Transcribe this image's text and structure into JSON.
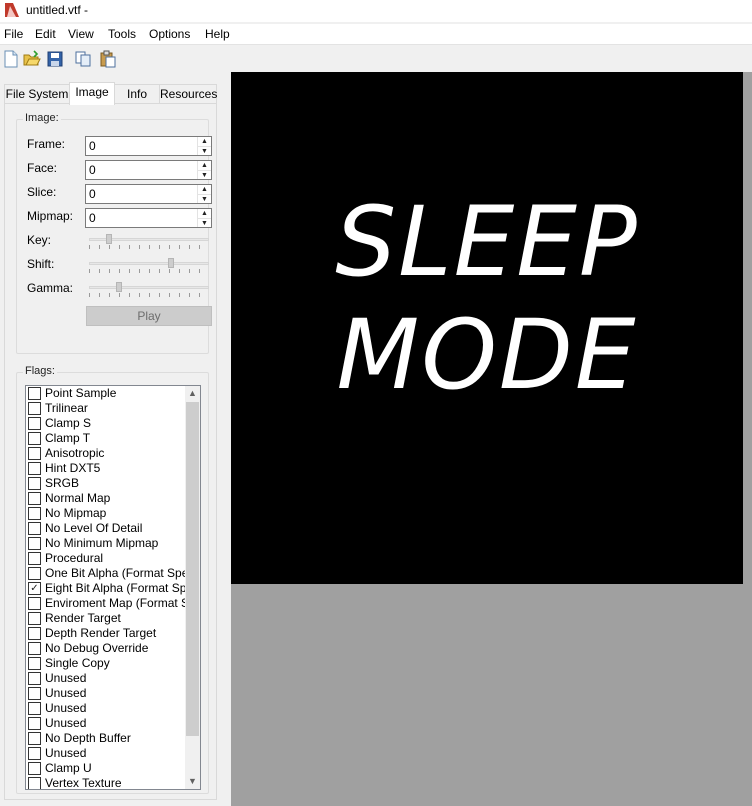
{
  "window": {
    "title": "untitled.vtf -"
  },
  "menu": [
    "File",
    "Edit",
    "View",
    "Tools",
    "Options",
    "Help"
  ],
  "toolbar": {
    "icons": [
      "new-icon",
      "open-icon",
      "save-icon",
      "copy-icon",
      "paste-icon"
    ]
  },
  "tabs": [
    "File System",
    "Image",
    "Info",
    "Resources"
  ],
  "image_group": {
    "legend": "Image:",
    "frame_label": "Frame:",
    "frame_value": "0",
    "face_label": "Face:",
    "face_value": "0",
    "slice_label": "Slice:",
    "slice_value": "0",
    "mipmap_label": "Mipmap:",
    "mipmap_value": "0",
    "key_label": "Key:",
    "key_level": 0.17,
    "shift_label": "Shift:",
    "shift_level": 0.68,
    "gamma_label": "Gamma:",
    "gamma_level": 0.25,
    "play_label": "Play"
  },
  "flags_group": {
    "legend": "Flags:",
    "items": [
      {
        "label": "Point Sample",
        "checked": false
      },
      {
        "label": "Trilinear",
        "checked": false
      },
      {
        "label": "Clamp S",
        "checked": false
      },
      {
        "label": "Clamp T",
        "checked": false
      },
      {
        "label": "Anisotropic",
        "checked": false
      },
      {
        "label": "Hint DXT5",
        "checked": false
      },
      {
        "label": "SRGB",
        "checked": false
      },
      {
        "label": "Normal Map",
        "checked": false
      },
      {
        "label": "No Mipmap",
        "checked": false
      },
      {
        "label": "No Level Of Detail",
        "checked": false
      },
      {
        "label": "No Minimum Mipmap",
        "checked": false
      },
      {
        "label": "Procedural",
        "checked": false
      },
      {
        "label": "One Bit Alpha (Format Spec",
        "checked": false
      },
      {
        "label": "Eight Bit Alpha (Format Spec",
        "checked": true
      },
      {
        "label": "Enviroment Map (Format Sp",
        "checked": false
      },
      {
        "label": "Render Target",
        "checked": false
      },
      {
        "label": "Depth Render Target",
        "checked": false
      },
      {
        "label": "No Debug Override",
        "checked": false
      },
      {
        "label": "Single Copy",
        "checked": false
      },
      {
        "label": "Unused",
        "checked": false
      },
      {
        "label": "Unused",
        "checked": false
      },
      {
        "label": "Unused",
        "checked": false
      },
      {
        "label": "Unused",
        "checked": false
      },
      {
        "label": "No Depth Buffer",
        "checked": false
      },
      {
        "label": "Unused",
        "checked": false
      },
      {
        "label": "Clamp U",
        "checked": false
      },
      {
        "label": "Vertex Texture",
        "checked": false
      }
    ]
  },
  "texture": {
    "line1": "SLEEP",
    "line2": "MODE"
  }
}
